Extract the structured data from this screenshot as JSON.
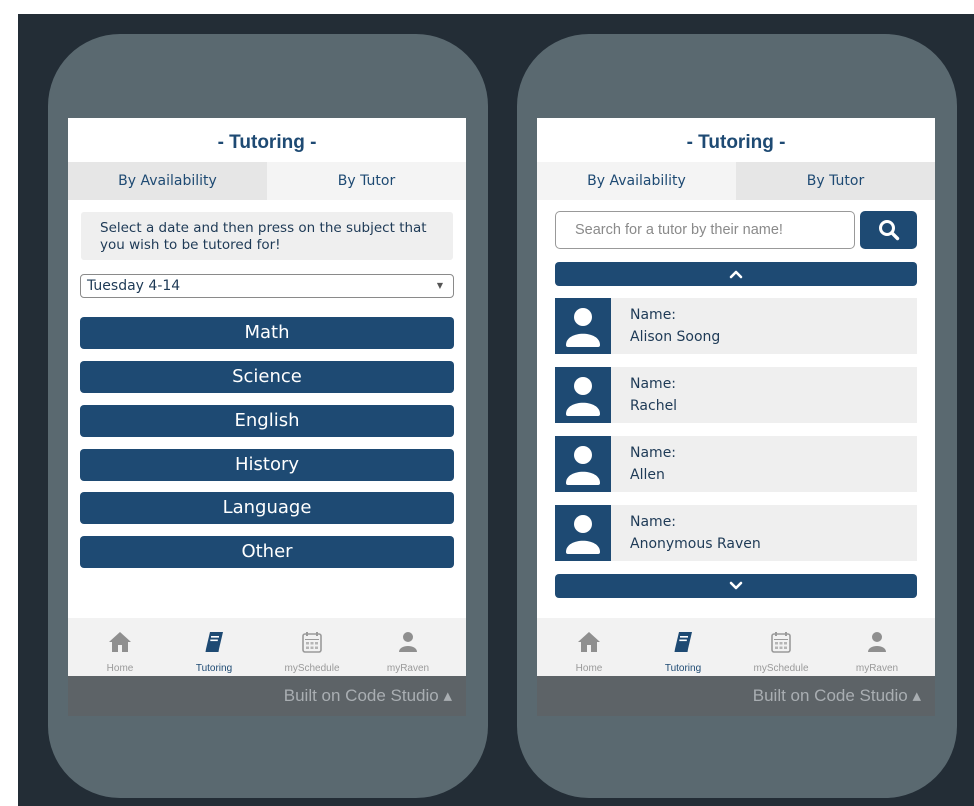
{
  "app": {
    "title": "- Tutoring -"
  },
  "tabs": {
    "availability": "By Availability",
    "tutor": "By Tutor"
  },
  "availability": {
    "instructions": "Select a date and then press on the subject that you wish to be tutored for!",
    "date": {
      "value": "Tuesday 4-14"
    },
    "subjects": [
      "Math",
      "Science",
      "English",
      "History",
      "Language",
      "Other"
    ]
  },
  "tutor": {
    "search_placeholder": "Search for a tutor by their name!",
    "name_label": "Name:",
    "tutors": [
      "Alison Soong",
      "Rachel",
      "Allen",
      "Anonymous Raven"
    ]
  },
  "nav": {
    "home": "Home",
    "tutoring": "Tutoring",
    "schedule": "mySchedule",
    "raven": "myRaven"
  },
  "footer": {
    "text": "Built on Code Studio ▴"
  },
  "colors": {
    "primary": "#1e4a73",
    "device": "#5a6970",
    "backdrop": "#232d36",
    "navbar": "#f2f2f2",
    "footer": "#5d6367"
  }
}
